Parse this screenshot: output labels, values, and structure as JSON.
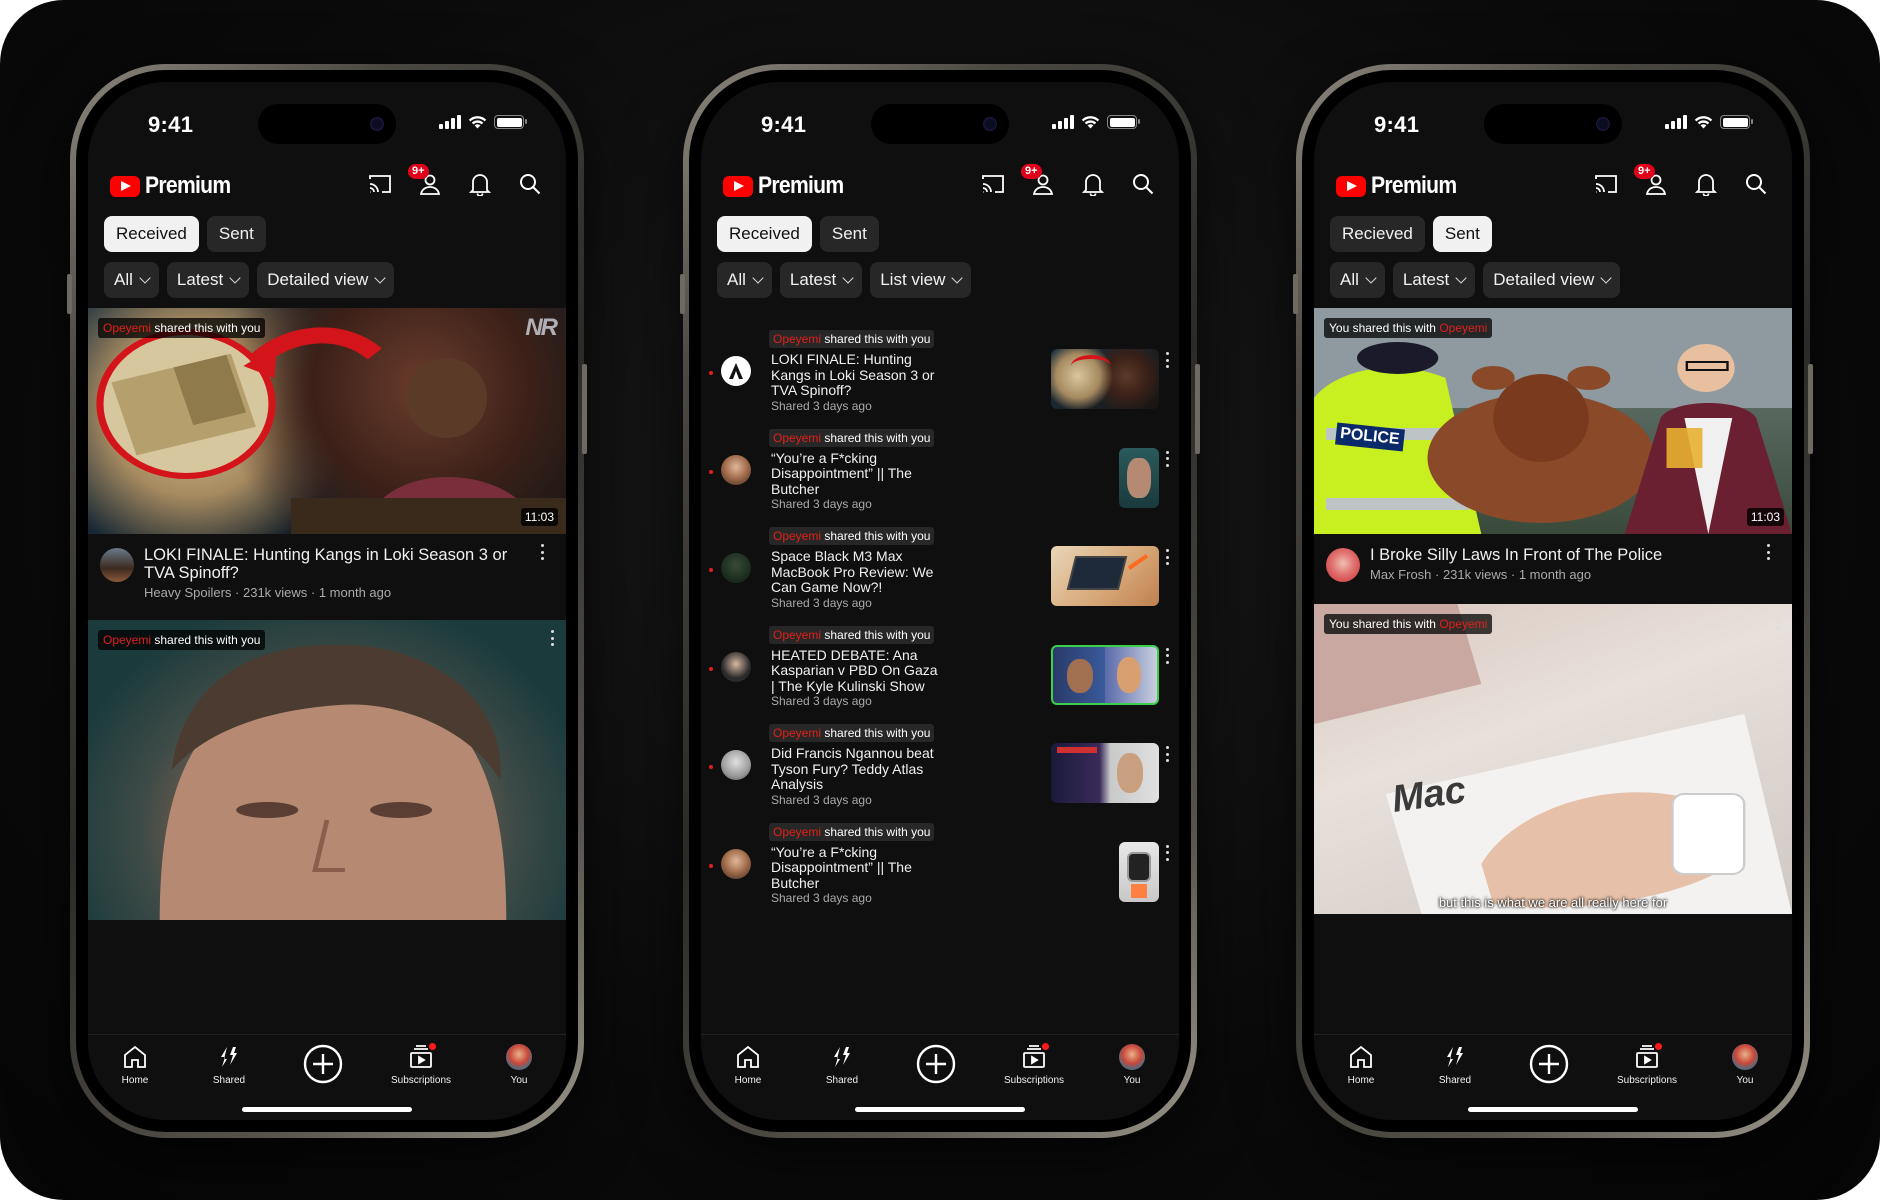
{
  "status": {
    "time": "9:41"
  },
  "app": {
    "logo_text": "Premium",
    "notification_badge": "9+"
  },
  "tabs": {
    "received": "Received",
    "sent": "Sent",
    "received_misspelled": "Recieved"
  },
  "filters": {
    "all": "All",
    "latest": "Latest",
    "detailed_view": "Detailed view",
    "list_view": "List view"
  },
  "labels": {
    "sender": "Opeyemi",
    "shared_with_you": "shared this with you",
    "you_shared": "You shared this with"
  },
  "phone1": {
    "cards": [
      {
        "title": "LOKI FINALE: Hunting Kangs in Loki Season 3 or TVA Spinoff?",
        "sub": "Heavy Spoilers · 231k views · 1 month ago",
        "duration": "11:03",
        "watermark": "NR"
      }
    ]
  },
  "phone2": {
    "rows": [
      {
        "title": "LOKI FINALE: Hunting Kangs in Loki Season 3 or TVA Spinoff?",
        "sub": "Shared 3 days ago"
      },
      {
        "title": "“You’re a F*cking Disappointment” || The Butcher",
        "sub": "Shared 3 days ago"
      },
      {
        "title": "Space Black M3 Max MacBook Pro Review: We Can Game Now?!",
        "sub": "Shared 3 days ago"
      },
      {
        "title": "HEATED DEBATE: Ana Kasparian v PBD On Gaza | The Kyle Kulinski Show",
        "sub": "Shared 3 days ago"
      },
      {
        "title": "Did Francis Ngannou beat Tyson Fury? Teddy Atlas Analysis",
        "sub": "Shared 3 days ago"
      },
      {
        "title": "“You’re a F*cking Disappointment” || The Butcher",
        "sub": "Shared 3 days ago"
      }
    ]
  },
  "phone3": {
    "cards": [
      {
        "title": "I Broke Silly Laws In Front of The Police",
        "sub": "Max Frosh · 231k views · 1 month ago",
        "duration": "11:03",
        "police_text": "POLICE"
      },
      {
        "caption": "but this is what we are all really here for",
        "box_text": "Mac"
      }
    ]
  },
  "nav": {
    "home": "Home",
    "shared": "Shared",
    "subscriptions": "Subscriptions",
    "you": "You"
  },
  "colors": {
    "accent_red": "#ff0000",
    "background": "#0f0f0f",
    "chip": "#272727"
  }
}
